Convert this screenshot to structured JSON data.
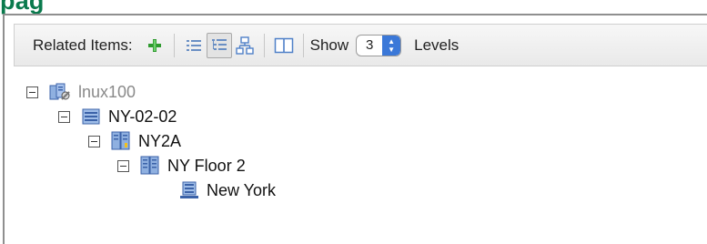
{
  "header": {
    "title_fragment": "pag"
  },
  "toolbar": {
    "related_items_label": "Related Items:",
    "show_label": "Show",
    "levels_value": "3",
    "levels_label": "Levels"
  },
  "tree": {
    "nodes": [
      {
        "label": "lnux100",
        "icon": "server-config-icon",
        "level": 0,
        "expanded": true,
        "muted": true
      },
      {
        "label": "NY-02-02",
        "icon": "rack-icon",
        "level": 1,
        "expanded": true
      },
      {
        "label": "NY2A",
        "icon": "cabinet-icon",
        "level": 2,
        "expanded": true
      },
      {
        "label": "NY Floor 2",
        "icon": "floor-icon",
        "level": 3,
        "expanded": true
      },
      {
        "label": "New York",
        "icon": "location-icon",
        "level": 4,
        "expanded": false
      }
    ]
  },
  "colors": {
    "title": "#0a7a4d",
    "add": "#2e9a2e",
    "icon_blue": "#4f80c8",
    "stepper_blue": "#3b78d8"
  }
}
